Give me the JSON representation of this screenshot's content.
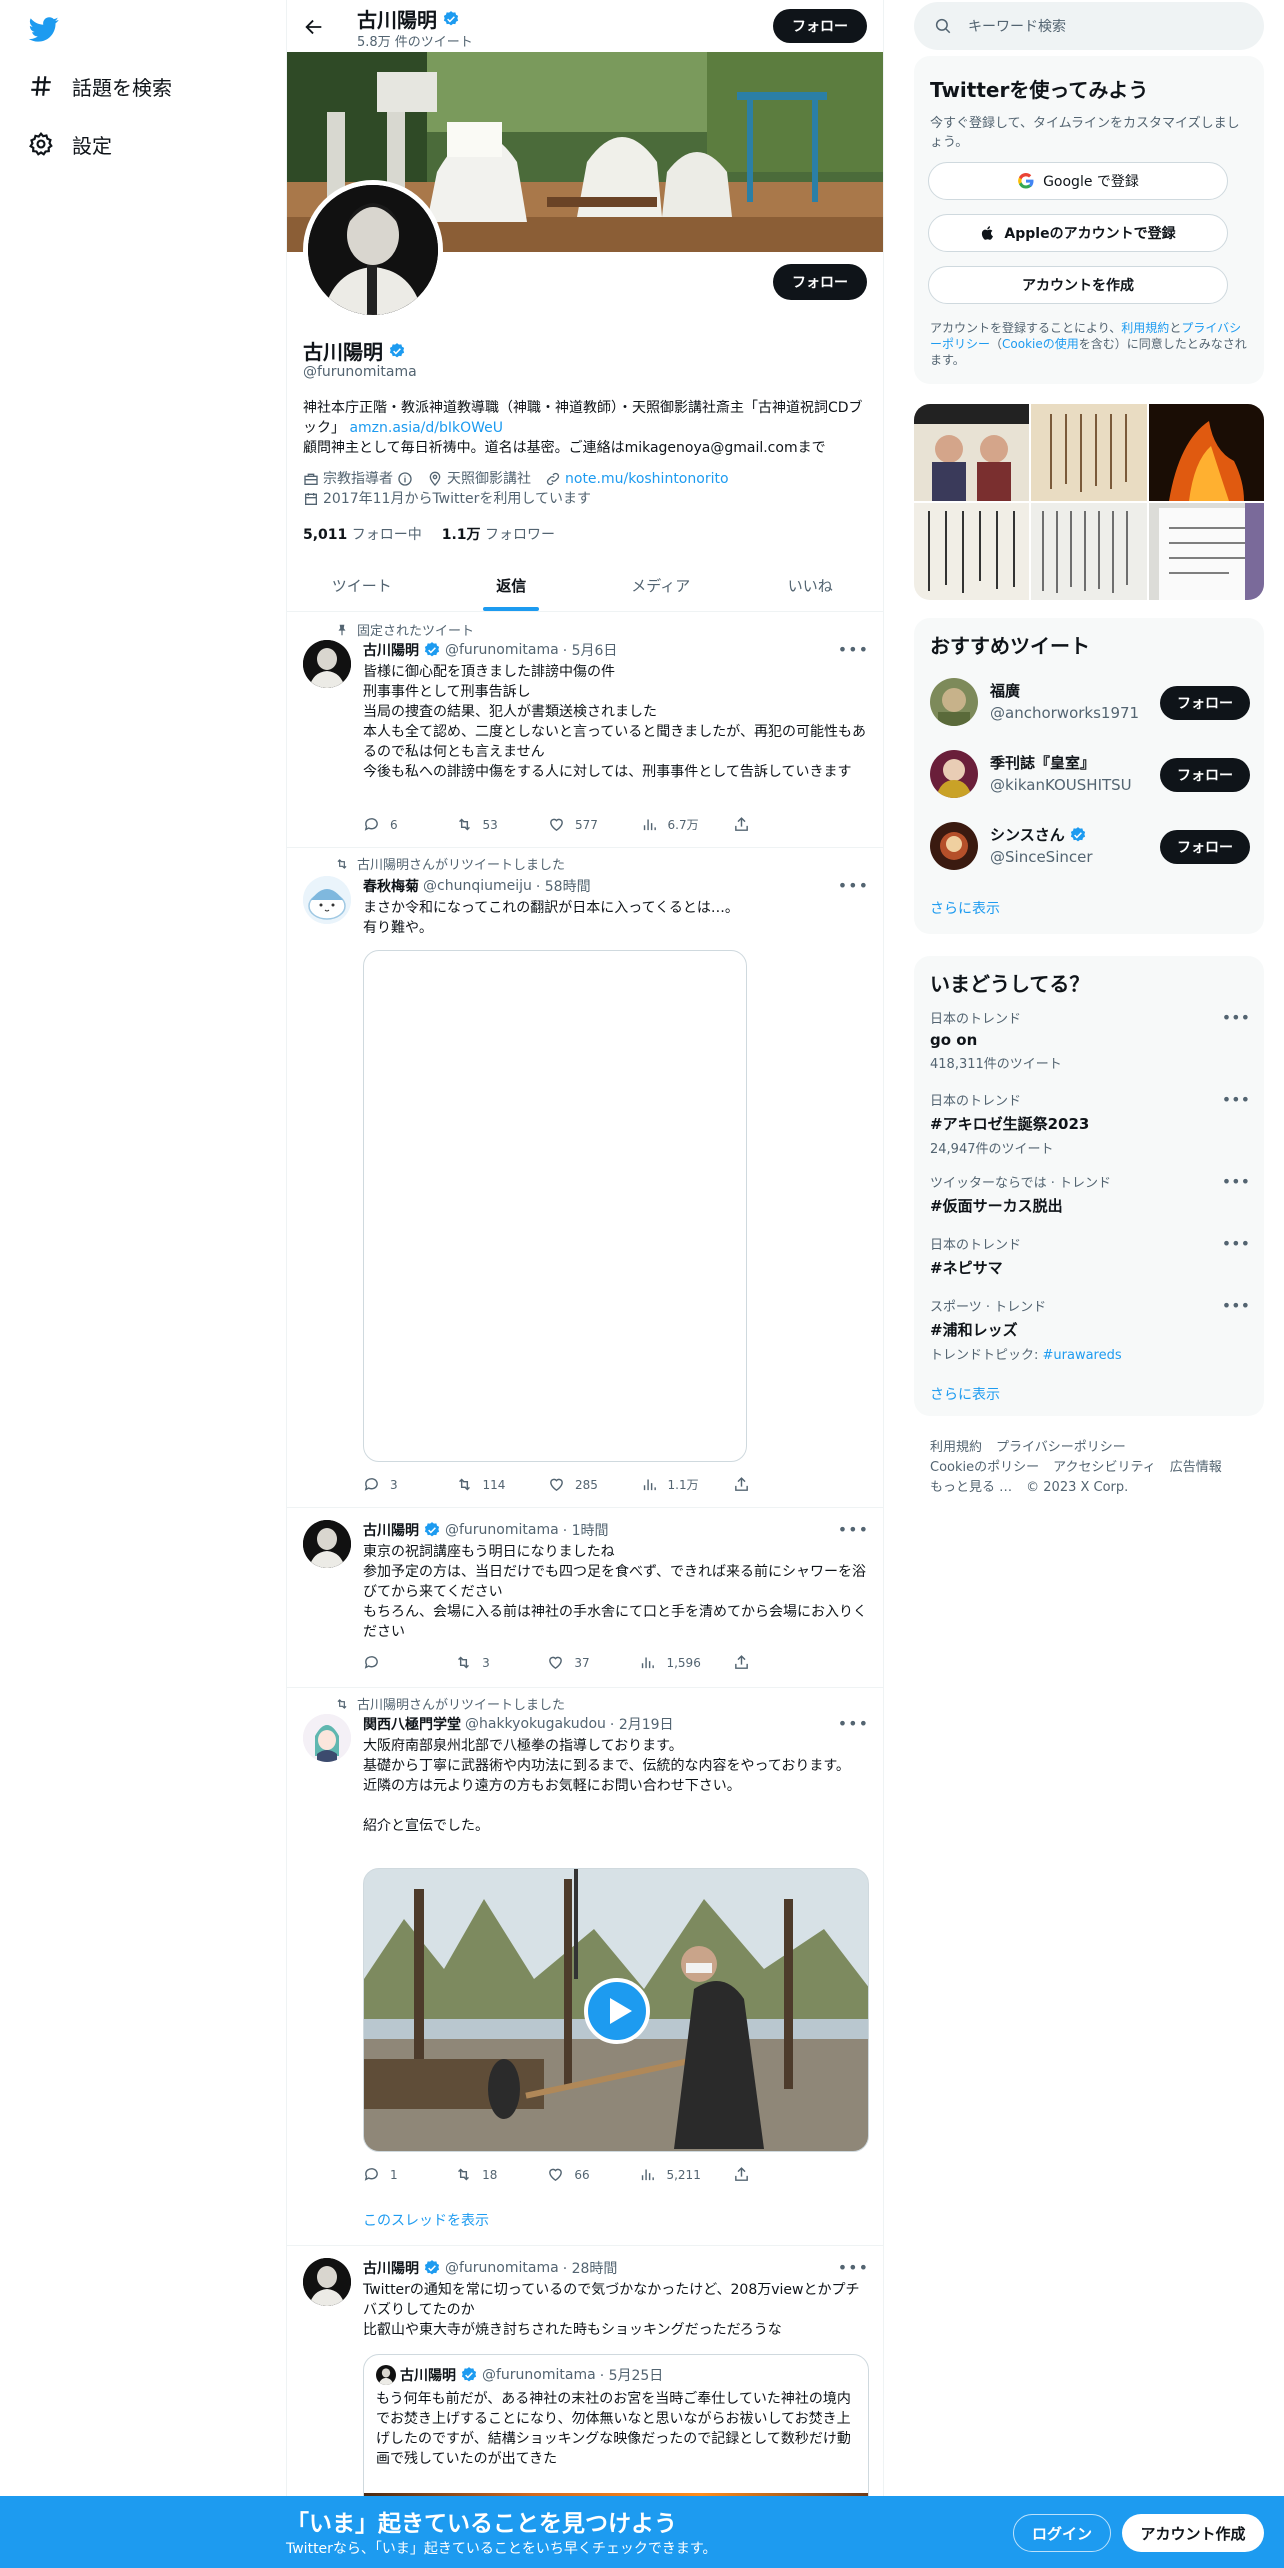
{
  "nav": {
    "items": [
      {
        "label": "話題を検索",
        "icon": "hashtag-icon"
      },
      {
        "label": "設定",
        "icon": "gear-icon"
      }
    ]
  },
  "header": {
    "name": "古川陽明",
    "tweet_count": "5.8万 件のツイート",
    "follow_label": "フォロー"
  },
  "profile": {
    "name": "古川陽明",
    "handle": "@furunomitama",
    "follow_label": "フォロー",
    "bio_line1": "神社本庁正階・教派神道教導職（神職・神道教師）・天照御影講社斎主「古神道祝詞CDブック」",
    "bio_link": "amzn.asia/d/bIkOWeU",
    "bio_line2": "顧問神主として毎日祈祷中。道名は基密。ご連絡はmikagenoya@gmail.comまで",
    "category": "宗教指導者",
    "location": "天照御影講社",
    "website": "note.mu/koshintonorito",
    "joined": "2017年11月からTwitterを利用しています",
    "following_count": "5,011",
    "following_label": "フォロー中",
    "followers_count": "1.1万",
    "followers_label": "フォロワー"
  },
  "tabs": [
    {
      "label": "ツイート",
      "active": false
    },
    {
      "label": "返信",
      "active": true
    },
    {
      "label": "メディア",
      "active": false
    },
    {
      "label": "いいね",
      "active": false
    }
  ],
  "tweets": [
    {
      "context": "固定されたツイート",
      "name": "古川陽明",
      "handle": "@furunomitama",
      "time": "· 5月6日",
      "text": "皆様に御心配を頂きました誹謗中傷の件\n刑事事件として刑事告訴し\n当局の捜査の結果、犯人が書類送検されました\n本人も全て認め、二度としないと言っていると聞きましたが、再犯の可能性もあるので私は何とも言えません\n今後も私への誹謗中傷をする人に対しては、刑事事件として告訴していきます",
      "replies": "6",
      "retweets": "53",
      "likes": "577",
      "views": "6.7万"
    },
    {
      "context": "古川陽明さんがリツイートしました",
      "name": "春秋梅菊",
      "handle": "@chunqiumeiju",
      "time": "· 58時間",
      "text": "まさか令和になってこれの翻訳が日本に入ってくるとは…。\n有り難や。",
      "replies": "3",
      "retweets": "114",
      "likes": "285",
      "views": "1.1万"
    },
    {
      "name": "古川陽明",
      "handle": "@furunomitama",
      "time": "· 1時間",
      "text": "東京の祝詞講座もう明日になりましたね\n参加予定の方は、当日だけでも四つ足を食べず、できれば来る前にシャワーを浴びてから来てください\nもちろん、会場に入る前は神社の手水舎にて口と手を清めてから会場にお入りください",
      "replies": "",
      "retweets": "3",
      "likes": "37",
      "views": "1,596"
    },
    {
      "context": "古川陽明さんがリツイートしました",
      "name": "関西八極門学堂",
      "handle": "@hakkyokugakudou",
      "time": "· 2月19日",
      "text": "大阪府南部泉州北部で八極拳の指導しております。\n基礎から丁寧に武器術や内功法に到るまで、伝統的な内容をやっております。\n近隣の方は元より遠方の方もお気軽にお問い合わせ下さい。\n\n紹介と宣伝でした。",
      "replies": "1",
      "retweets": "18",
      "likes": "66",
      "views": "5,211",
      "thread_link": "このスレッドを表示"
    },
    {
      "name": "古川陽明",
      "handle": "@furunomitama",
      "time": "· 28時間",
      "text": "Twitterの通知を常に切っているので気づかなかったけど、208万viewとかプチバズりしてたのか\n比叡山や東大寺が焼き討ちされた時もショッキングだっただろうな",
      "quote": {
        "name": "古川陽明",
        "handle": "@furunomitama",
        "time": "· 5月25日",
        "text": "もう何年も前だが、ある神社の末社のお宮を当時ご奉仕していた神社の境内でお焚き上げすることになり、勿体無いなと思いながらお祓いしてお焚き上げしたのですが、結構ショッキングな映像だったので記録として数秒だけ動画で残していたのが出てきた"
      }
    }
  ],
  "right": {
    "search_placeholder": "キーワード検索",
    "signup": {
      "title": "Twitterを使ってみよう",
      "subtitle": "今すぐ登録して、タイムラインをカスタマイズしましょう。",
      "google": "Google で登録",
      "apple": "Appleのアカウントで登録",
      "create": "アカウントを作成",
      "legal_pre": "アカウントを登録することにより、",
      "legal_terms": "利用規約",
      "legal_and": "と",
      "legal_privacy": "プライバシーポリシー",
      "legal_paren_open": "（",
      "legal_cookie": "Cookieの使用",
      "legal_post": "を含む）に同意したとみなされます。"
    },
    "recommend": {
      "title": "おすすめツイート",
      "follow_label": "フォロー",
      "items": [
        {
          "name": "福廣",
          "handle": "@anchorworks1971",
          "verified": false
        },
        {
          "name": "季刊誌『皇室』",
          "handle": "@kikanKOUSHITSU",
          "verified": false
        },
        {
          "name": "シンスさん",
          "handle": "@SinceSincer",
          "verified": true
        }
      ],
      "more": "さらに表示"
    },
    "trends": {
      "title": "いまどうしてる？",
      "items": [
        {
          "category": "日本のトレンド",
          "title": "go on",
          "sub": "418,311件のツイート"
        },
        {
          "category": "日本のトレンド",
          "title": "#アキロゼ生誕祭2023",
          "sub": "24,947件のツイート"
        },
        {
          "category": "ツイッターならでは · トレンド",
          "title": "#仮面サーカス脱出",
          "sub": ""
        },
        {
          "category": "日本のトレンド",
          "title": "#ネピサマ",
          "sub": ""
        },
        {
          "category": "スポーツ · トレンド",
          "title": "#浦和レッズ",
          "sub_pre": "トレンドトピック: ",
          "sub_link": "#urawareds"
        }
      ],
      "more": "さらに表示"
    },
    "footer": {
      "links": [
        "利用規約",
        "プライバシーポリシー",
        "Cookieのポリシー",
        "アクセシビリティ",
        "広告情報",
        "もっと見る …",
        "© 2023 X Corp."
      ]
    }
  },
  "bottom": {
    "title": "「いま」起きていることを見つけよう",
    "subtitle": "Twitterなら、「いま」起きていることをいち早くチェックできます。",
    "login": "ログイン",
    "signup": "アカウント作成"
  },
  "colors": {
    "accent": "#1d9bf0",
    "text": "#0f1419",
    "secondary": "#536471"
  }
}
